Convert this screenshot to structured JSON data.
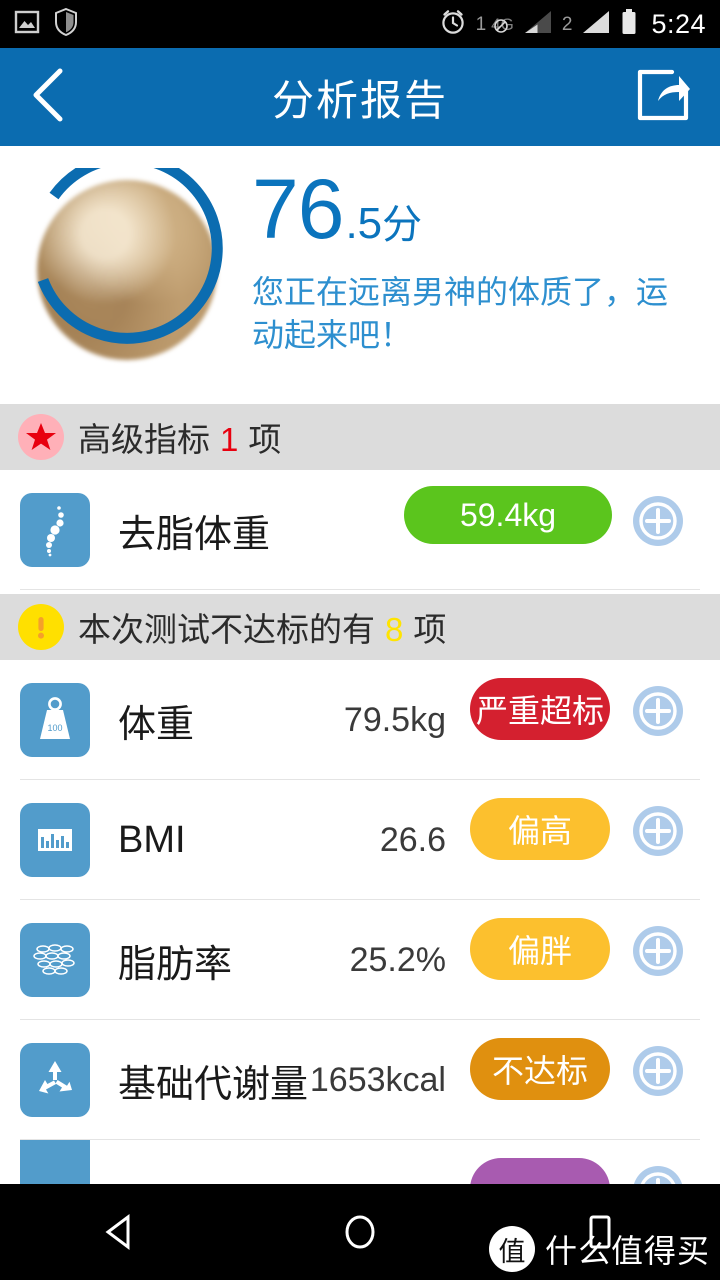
{
  "status_bar": {
    "icons": [
      "image-icon",
      "shield-icon"
    ],
    "alarm_icon": "alarm-clock-icon",
    "sim1_label": "1",
    "network_label": "4G",
    "network_disabled": true,
    "sim2_label": "2",
    "battery_icon": "battery-full-icon",
    "time": "5:24"
  },
  "header": {
    "back_icon": "chevron-left-icon",
    "title": "分析报告",
    "share_icon": "share-icon",
    "background": "#0b6cb0"
  },
  "score": {
    "avatar_name": "user-avatar",
    "integer": "76",
    "decimal": ".5",
    "unit": "分",
    "message": "您正在远离男神的体质了，运动起来吧！",
    "color": "#0b74bd"
  },
  "sections": [
    {
      "icon": "star-icon",
      "icon_bg": "#ffb0b8",
      "text_before": "高级指标",
      "count": "1",
      "count_color": "#e8000f",
      "text_after": "项"
    },
    {
      "icon": "exclamation-icon",
      "icon_bg": "#ffe000",
      "text_before": "本次测试不达标的有",
      "count": "8",
      "count_color": "#ffe400",
      "text_after": "项"
    }
  ],
  "advanced_rows": [
    {
      "icon": "spine-dots-icon",
      "label": "去脂体重",
      "value": "",
      "badge": "59.4kg",
      "badge_color": "#5bc51d",
      "action_icon": "plus-circle-icon"
    }
  ],
  "failed_rows": [
    {
      "icon": "weight-scale-icon",
      "label": "体重",
      "value": "79.5kg",
      "badge": "严重超标",
      "badge_color": "#d4202f",
      "action_icon": "plus-circle-icon"
    },
    {
      "icon": "bar-chart-icon",
      "label": "BMI",
      "value": "26.6",
      "badge": "偏高",
      "badge_color": "#fcc02e",
      "action_icon": "plus-circle-icon"
    },
    {
      "icon": "fat-tissue-icon",
      "label": "脂肪率",
      "value": "25.2%",
      "badge": "偏胖",
      "badge_color": "#fcc02e",
      "action_icon": "plus-circle-icon"
    },
    {
      "icon": "recycle-icon",
      "label": "基础代谢量",
      "value": "1653kcal",
      "badge": "不达标",
      "badge_color": "#e0900f",
      "action_icon": "plus-circle-icon"
    },
    {
      "icon": "partial-icon",
      "label": "",
      "value": "",
      "badge": "",
      "badge_color": "#a85bb0",
      "action_icon": "plus-circle-icon"
    }
  ],
  "nav_bar": {
    "back_icon": "nav-back-triangle-icon",
    "home_icon": "nav-home-circle-icon",
    "recents_icon": "nav-recents-square-icon"
  },
  "watermark": {
    "badge_text": "值",
    "text": "什么值得买"
  }
}
